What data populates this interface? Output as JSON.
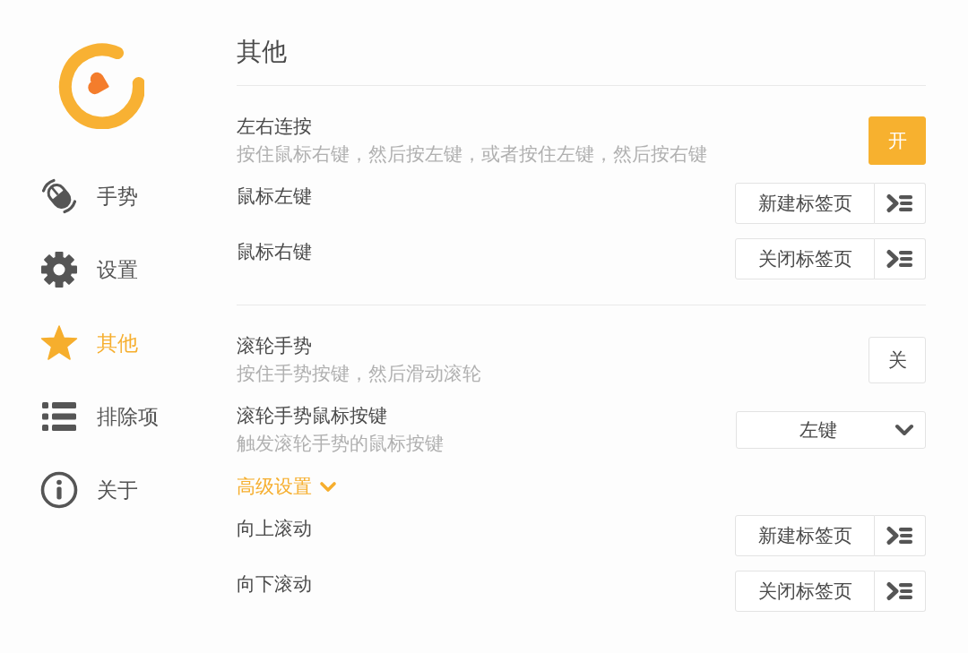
{
  "sidebar": {
    "items": [
      {
        "label": "手势",
        "selected": false
      },
      {
        "label": "设置",
        "selected": false
      },
      {
        "label": "其他",
        "selected": true
      },
      {
        "label": "排除项",
        "selected": false
      },
      {
        "label": "关于",
        "selected": false
      }
    ]
  },
  "page": {
    "title": "其他"
  },
  "sections": [
    {
      "rows": [
        {
          "kind": "toggle",
          "label": "左右连按",
          "description": "按住鼠标右键，然后按左键，或者按住左键，然后按右键",
          "on": true,
          "button": "开"
        },
        {
          "kind": "action",
          "label": "鼠标左键",
          "action": "新建标签页"
        },
        {
          "kind": "action",
          "label": "鼠标右键",
          "action": "关闭标签页"
        }
      ]
    },
    {
      "rows": [
        {
          "kind": "toggle",
          "label": "滚轮手势",
          "description": "按住手势按键，然后滑动滚轮",
          "on": false,
          "button": "关"
        },
        {
          "kind": "select",
          "label": "滚轮手势鼠标按键",
          "description": "触发滚轮手势的鼠标按键",
          "value": "左键"
        },
        {
          "kind": "expander",
          "label": "高级设置",
          "expanded": true
        },
        {
          "kind": "action",
          "label": "向上滚动",
          "action": "新建标签页"
        },
        {
          "kind": "action",
          "label": "向下滚动",
          "action": "关闭标签页"
        }
      ]
    }
  ]
}
